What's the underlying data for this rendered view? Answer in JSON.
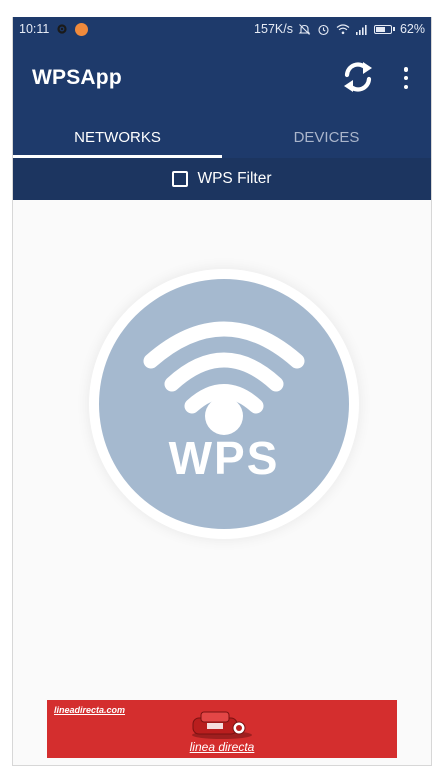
{
  "status_bar": {
    "time": "10:11",
    "speed": "157K/s",
    "battery_percent": "62%",
    "battery_level": 0.62,
    "icons": [
      "gear-icon",
      "app-notification-icon",
      "mute-icon",
      "alarm-icon",
      "wifi-icon",
      "signal-icon",
      "battery-icon"
    ]
  },
  "app_bar": {
    "title": "WPSApp",
    "refresh_icon": "refresh-icon",
    "more_icon": "more-vert-icon"
  },
  "tabs": [
    {
      "label": "NETWORKS",
      "active": true
    },
    {
      "label": "DEVICES",
      "active": false
    }
  ],
  "filter": {
    "label": "WPS Filter",
    "checked": false
  },
  "logo": {
    "text": "WPS",
    "icon": "wifi-icon",
    "color": "#a5b9cf"
  },
  "ad": {
    "url": "lineadirecta.com",
    "brand": "linea directa",
    "color": "#d42e2e"
  },
  "colors": {
    "primary": "#1e3a6b",
    "filter_bar": "#1c3560",
    "background": "#fafafa"
  }
}
